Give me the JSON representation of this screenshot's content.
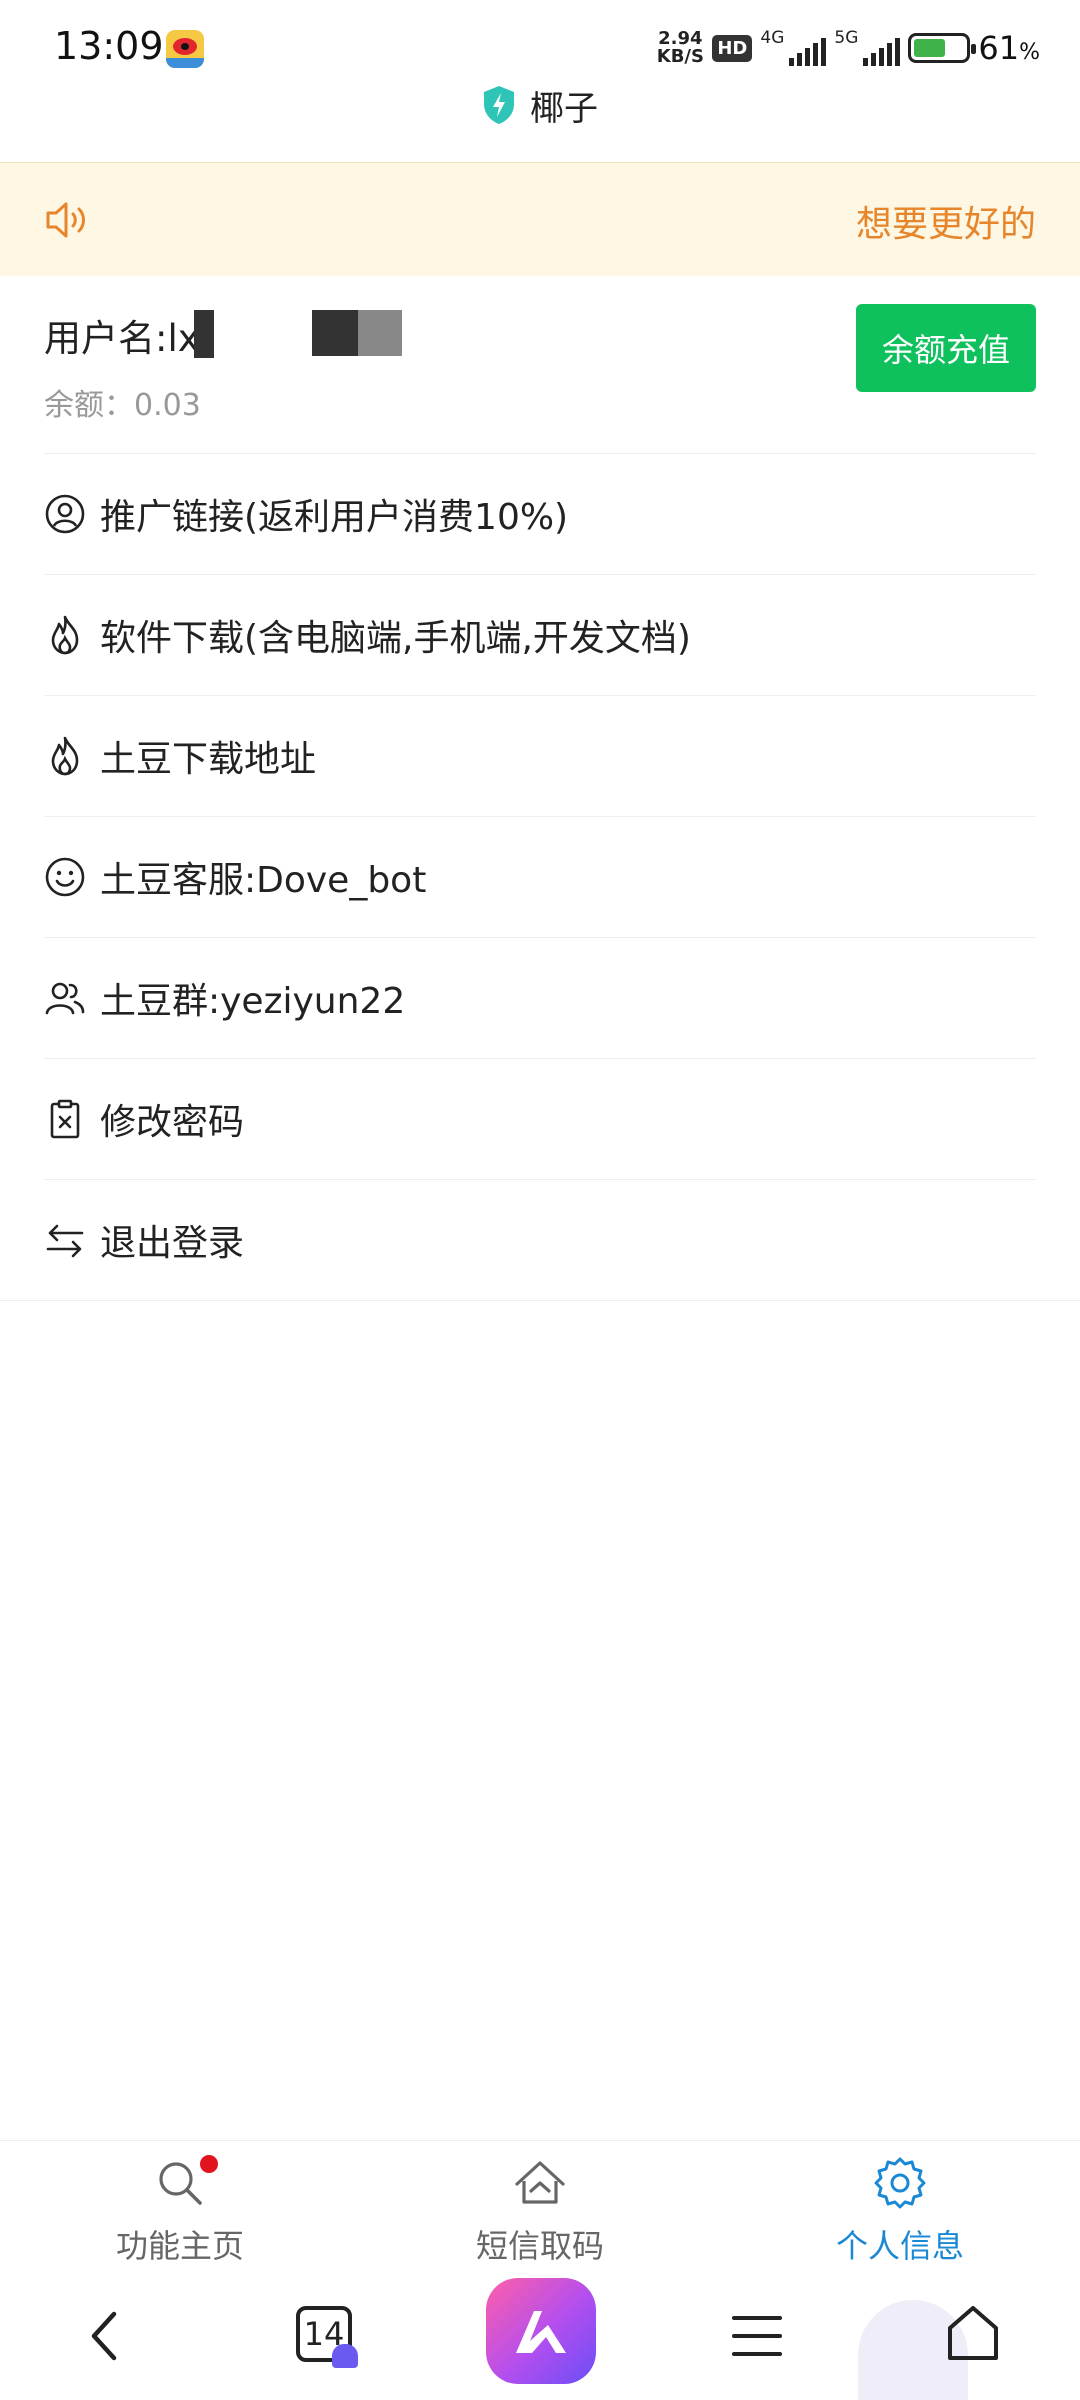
{
  "status_bar": {
    "time": "13:09",
    "speed_value": "2.94",
    "speed_unit": "KB/S",
    "hd_label": "HD",
    "net1": "4G",
    "net2": "5G",
    "battery_percent": "61",
    "battery_unit": "%",
    "battery_level": 0.61
  },
  "header": {
    "title": "椰子"
  },
  "notice": {
    "text": "想要更好的"
  },
  "user": {
    "username_label": "用户名:lx",
    "balance_label": "余额：",
    "balance_value": "0.03",
    "recharge_button": "余额充值"
  },
  "menu": [
    {
      "icon": "user-circle-icon",
      "label": "推广链接(返利用户消费10%)"
    },
    {
      "icon": "flame-icon",
      "label": "软件下载(含电脑端,手机端,开发文档)"
    },
    {
      "icon": "flame-icon",
      "label": "土豆下载地址"
    },
    {
      "icon": "smile-icon",
      "label": "土豆客服:Dove_bot"
    },
    {
      "icon": "users-icon",
      "label": "土豆群:yeziyun22"
    },
    {
      "icon": "clipboard-icon",
      "label": "修改密码"
    },
    {
      "icon": "swap-icon",
      "label": "退出登录"
    }
  ],
  "tabbar": {
    "tabs": [
      {
        "icon": "search-icon",
        "label": "功能主页",
        "active": false,
        "has_badge": true
      },
      {
        "icon": "home-icon",
        "label": "短信取码",
        "active": false,
        "has_badge": false
      },
      {
        "icon": "settings-icon",
        "label": "个人信息",
        "active": true,
        "has_badge": false
      }
    ]
  },
  "sysnav": {
    "tab_count": "14"
  },
  "colors": {
    "accent_green": "#0ec15c",
    "active_blue": "#1a88d4",
    "notice_bg": "#fdf7e3",
    "notice_text": "#e7852a",
    "badge_red": "#e1141e"
  }
}
